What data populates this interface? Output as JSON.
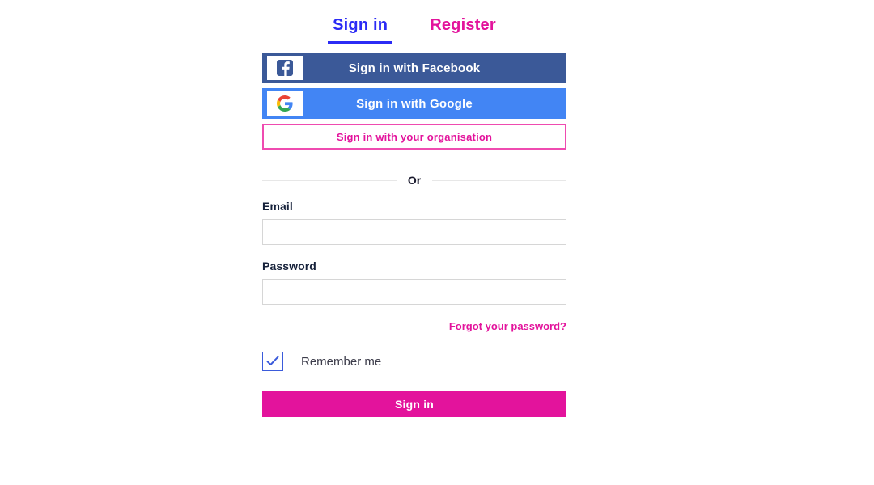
{
  "tabs": [
    {
      "label": "Sign in",
      "active": true,
      "name": "tab-sign-in"
    },
    {
      "label": "Register",
      "active": false,
      "name": "tab-register"
    }
  ],
  "social": {
    "facebook": {
      "label": "Sign in with Facebook",
      "icon": "facebook-icon",
      "background": "#3b5998"
    },
    "google": {
      "label": "Sign in with Google",
      "icon": "google-icon",
      "background": "#4285f4"
    },
    "organisation": {
      "label": "Sign in with your organisation",
      "border_color": "#ef4bb0",
      "text_color": "#e3139c"
    }
  },
  "divider": {
    "label": "Or"
  },
  "form": {
    "email": {
      "label": "Email",
      "value": "",
      "placeholder": ""
    },
    "password": {
      "label": "Password",
      "value": "",
      "placeholder": ""
    },
    "forgot_password": {
      "label": "Forgot your password?"
    },
    "remember_me": {
      "label": "Remember me",
      "checked": true,
      "check_glyph": "✓"
    },
    "submit": {
      "label": "Sign in"
    }
  },
  "colors": {
    "primary_blue": "#2b2bf5",
    "magenta": "#e3139c",
    "facebook_blue": "#3b5998",
    "google_blue": "#4285f4",
    "checkbox_blue": "#3b5bdb"
  }
}
